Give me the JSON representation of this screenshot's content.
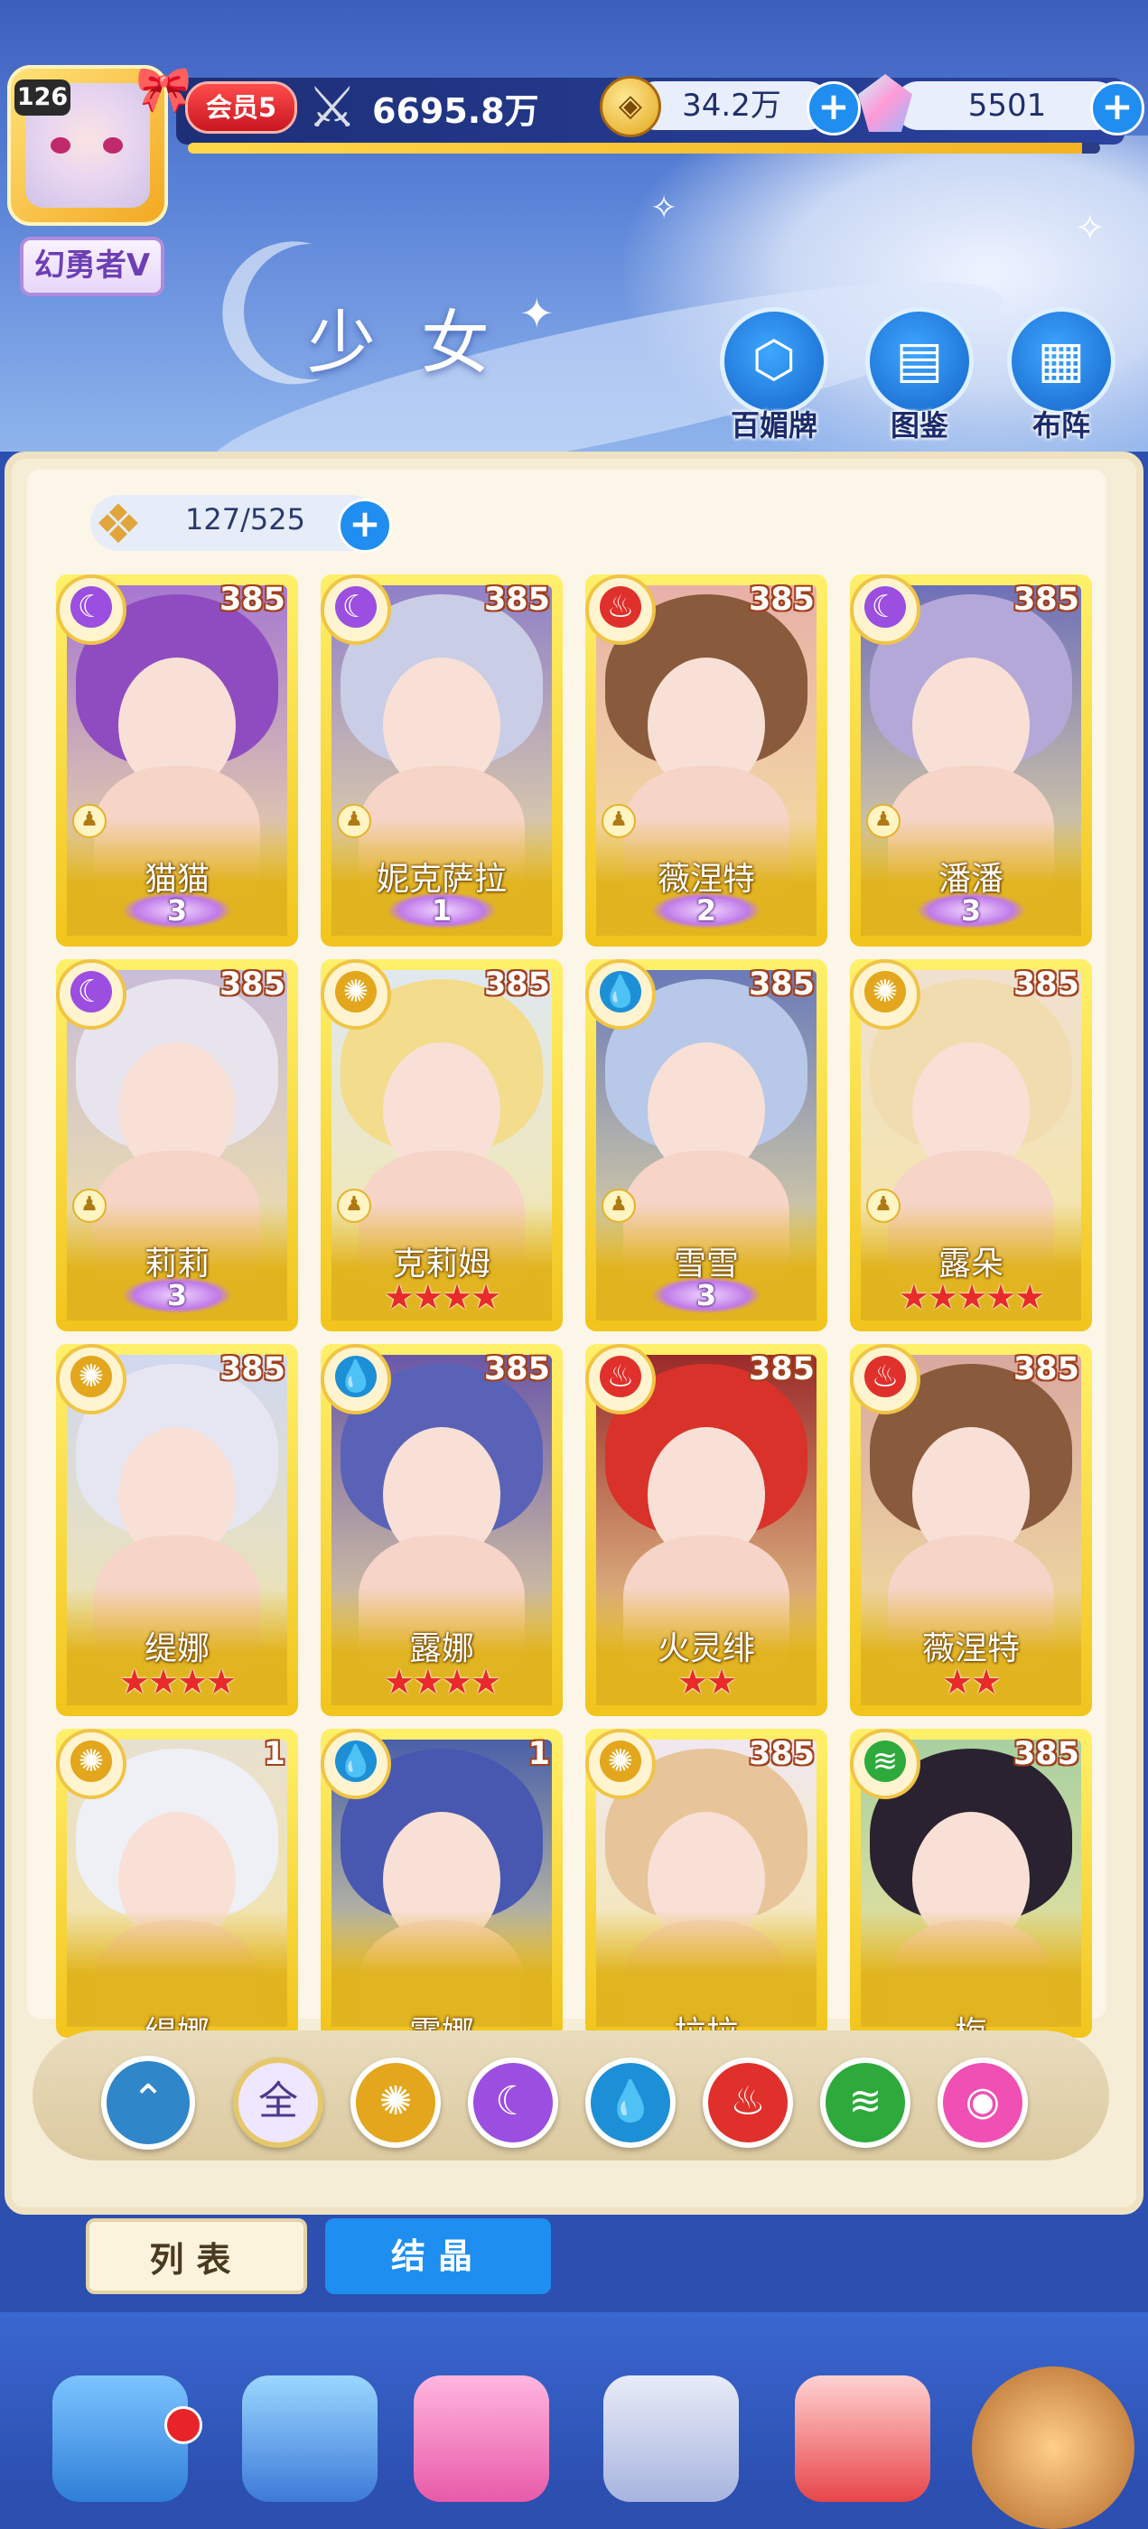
{
  "player": {
    "level": "126",
    "title": "幻勇者V",
    "vip": "会员5",
    "power": "6695.8万",
    "exp_fraction": 0.98
  },
  "resources": {
    "coins": "34.2万",
    "gems": "5501"
  },
  "page": {
    "title": "少女"
  },
  "top_buttons": [
    {
      "label": "百媚牌",
      "icon": "card-deck-icon"
    },
    {
      "label": "图鉴",
      "icon": "book-icon"
    },
    {
      "label": "布阵",
      "icon": "grid-formation-icon"
    }
  ],
  "collection": {
    "count": "127",
    "capacity": "525"
  },
  "characters": [
    {
      "name": "猫猫",
      "level": "385",
      "element": "moon",
      "rank_type": "wings",
      "rank": "3"
    },
    {
      "name": "妮克萨拉",
      "level": "385",
      "element": "moon",
      "rank_type": "wings",
      "rank": "1"
    },
    {
      "name": "薇涅特",
      "level": "385",
      "element": "fire",
      "rank_type": "wings",
      "rank": "2"
    },
    {
      "name": "潘潘",
      "level": "385",
      "element": "moon",
      "rank_type": "wings",
      "rank": "3"
    },
    {
      "name": "莉莉",
      "level": "385",
      "element": "moon",
      "rank_type": "wings",
      "rank": "3"
    },
    {
      "name": "克莉姆",
      "level": "385",
      "element": "sun",
      "rank_type": "stars",
      "rank": "4"
    },
    {
      "name": "雪雪",
      "level": "385",
      "element": "water",
      "rank_type": "wings",
      "rank": "3"
    },
    {
      "name": "露朵",
      "level": "385",
      "element": "sun",
      "rank_type": "stars",
      "rank": "5"
    },
    {
      "name": "缇娜",
      "level": "385",
      "element": "sun",
      "rank_type": "stars",
      "rank": "4"
    },
    {
      "name": "露娜",
      "level": "385",
      "element": "water",
      "rank_type": "stars",
      "rank": "4"
    },
    {
      "name": "火灵绯",
      "level": "385",
      "element": "fire",
      "rank_type": "stars",
      "rank": "2"
    },
    {
      "name": "薇涅特",
      "level": "385",
      "element": "fire",
      "rank_type": "stars",
      "rank": "2"
    },
    {
      "name": "缇娜",
      "level": "1",
      "element": "sun",
      "rank_type": "none",
      "rank": ""
    },
    {
      "name": "露娜",
      "level": "1",
      "element": "water",
      "rank_type": "none",
      "rank": ""
    },
    {
      "name": "拉拉",
      "level": "385",
      "element": "sun",
      "rank_type": "none",
      "rank": ""
    },
    {
      "name": "梅",
      "level": "385",
      "element": "wind",
      "rank_type": "none",
      "rank": ""
    }
  ],
  "filters": [
    {
      "id": "sort",
      "label": "",
      "icon": "sort-chevron-icon",
      "color": "#2f86c9"
    },
    {
      "id": "all",
      "label": "全",
      "icon": "all-icon",
      "color": "#efe6ff"
    },
    {
      "id": "sun",
      "label": "",
      "icon": "sun-icon",
      "color": "#e3a61c"
    },
    {
      "id": "moon",
      "label": "",
      "icon": "moon-icon",
      "color": "#9b4ee0"
    },
    {
      "id": "water",
      "label": "",
      "icon": "water-drop-icon",
      "color": "#1d8fd6"
    },
    {
      "id": "fire",
      "label": "",
      "icon": "fire-icon",
      "color": "#e0302b"
    },
    {
      "id": "wind",
      "label": "",
      "icon": "wind-icon",
      "color": "#2eaa3c"
    },
    {
      "id": "heart",
      "label": "",
      "icon": "heart-orb-icon",
      "color": "#f04fb3"
    }
  ],
  "tabs": {
    "list": "列表",
    "crystal": "结晶"
  },
  "nav": [
    {
      "icon": "castle-icon"
    },
    {
      "icon": "star-shield-icon"
    },
    {
      "icon": "hearts-icon"
    },
    {
      "icon": "character-icon"
    },
    {
      "icon": "gift-box-icon"
    },
    {
      "icon": "compass-icon"
    }
  ],
  "colors": {
    "gold": "#f2c41c",
    "header_blue": "#3c5fbe",
    "accent_blue": "#1f8ef0"
  }
}
